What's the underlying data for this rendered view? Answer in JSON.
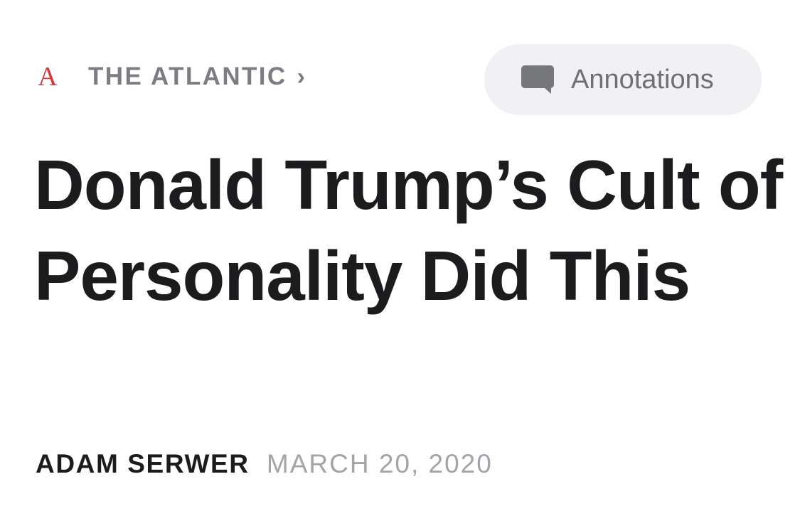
{
  "header": {
    "publication": {
      "logo_letter": "A",
      "name": "THE ATLANTIC",
      "chevron": "›"
    },
    "annotations_button": {
      "icon": "speech-bubble-icon",
      "label": "Annotations"
    }
  },
  "article": {
    "title": "Donald Trump’s Cult of Personality Did This",
    "author": "ADAM SERWER",
    "date": "MARCH 20, 2020"
  },
  "colors": {
    "logo": "#d9383a",
    "publication_text": "#7c7d82",
    "button_background": "#f1f1f3",
    "button_text": "#6f7074",
    "headline": "#1c1c1e",
    "date": "#a3a3a8"
  }
}
